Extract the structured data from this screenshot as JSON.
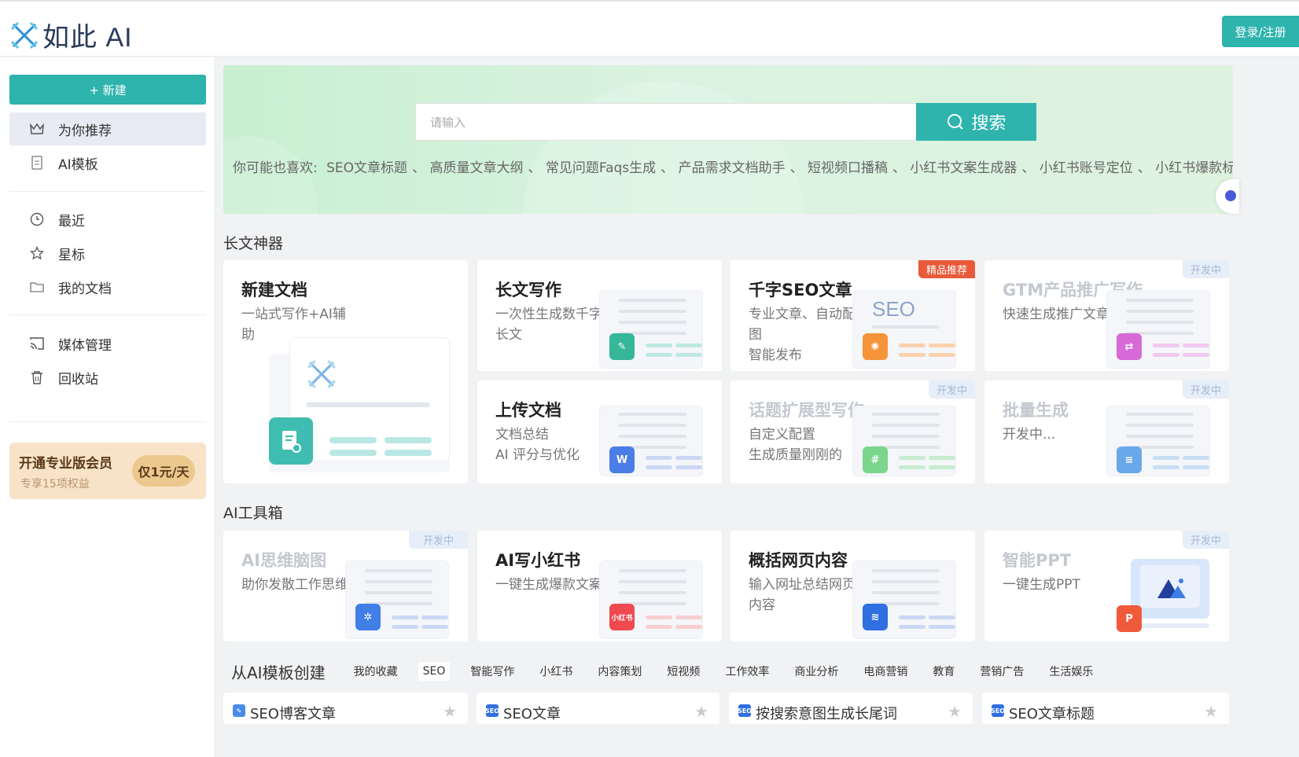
{
  "brand": {
    "name": "如此 AI"
  },
  "header": {
    "login": "登录/注册"
  },
  "sidebar": {
    "new_label": "+ 新建",
    "items": [
      {
        "label": "为你推荐",
        "icon": "crown-icon"
      },
      {
        "label": "AI模板",
        "icon": "document-icon"
      },
      {
        "label": "最近",
        "icon": "clock-icon"
      },
      {
        "label": "星标",
        "icon": "star-icon"
      },
      {
        "label": "我的文档",
        "icon": "folder-icon"
      },
      {
        "label": "媒体管理",
        "icon": "cast-icon"
      },
      {
        "label": "回收站",
        "icon": "trash-icon"
      }
    ],
    "vip": {
      "title": "开通专业版会员",
      "sub": "专享15项权益",
      "price": "仅1元/天"
    }
  },
  "search": {
    "placeholder": "请输入",
    "button": "搜索",
    "suggest_label": "你可能也喜欢:",
    "suggestions": [
      "SEO文章标题",
      "高质量文章大纲",
      "常见问题Faqs生成",
      "产品需求文档助手",
      "短视频口播稿",
      "小红书文案生成器",
      "小红书账号定位",
      "小红书爆款标题"
    ]
  },
  "sections": {
    "long": "长文神器",
    "tools": "AI工具箱",
    "templates": "从AI模板创建"
  },
  "cards": {
    "newdoc": {
      "title": "新建文档",
      "desc": "一站式写作+AI辅助"
    },
    "longwrite": {
      "title": "长文写作",
      "desc": "一次性生成数千字长文"
    },
    "seo": {
      "title": "千字SEO文章",
      "desc1": "专业文章、自动配图",
      "desc2": "智能发布",
      "badge": "精品推荐",
      "seo_text": "SEO"
    },
    "gtm": {
      "title": "GTM产品推广写作",
      "desc": "快速生成推广文章",
      "badge": "开发中"
    },
    "upload": {
      "title": "上传文档",
      "desc1": "文档总结",
      "desc2": "AI 评分与优化"
    },
    "topic": {
      "title": "话题扩展型写作",
      "desc1": "自定义配置",
      "desc2": "生成质量刚刚的",
      "badge": "开发中"
    },
    "batch": {
      "title": "批量生成",
      "desc": "开发中...",
      "badge": "开发中"
    },
    "mindmap": {
      "title": "AI思维脑图",
      "desc": "助你发散工作思维",
      "badge": "开发中"
    },
    "xhs": {
      "title": "AI写小红书",
      "desc": "一键生成爆款文案",
      "icon_text": "小红书"
    },
    "summary": {
      "title": "概括网页内容",
      "desc": "输入网址总结网页内容"
    },
    "ppt": {
      "title": "智能PPT",
      "desc": "一键生成PPT",
      "badge": "开发中"
    }
  },
  "template_tabs": [
    "我的收藏",
    "SEO",
    "智能写作",
    "小红书",
    "内容策划",
    "短视频",
    "工作效率",
    "商业分析",
    "电商营销",
    "教育",
    "营销广告",
    "生活娱乐"
  ],
  "template_cards": [
    {
      "name": "SEO博客文章",
      "icon": "edit-icon"
    },
    {
      "name": "SEO文章",
      "icon": "seo-icon"
    },
    {
      "name": "按搜索意图生成长尾词",
      "icon": "seo-icon"
    },
    {
      "name": "SEO文章标题",
      "icon": "seo-icon"
    }
  ],
  "colors": {
    "accent": "#2eb3ad",
    "hot": "#e85a3a"
  }
}
